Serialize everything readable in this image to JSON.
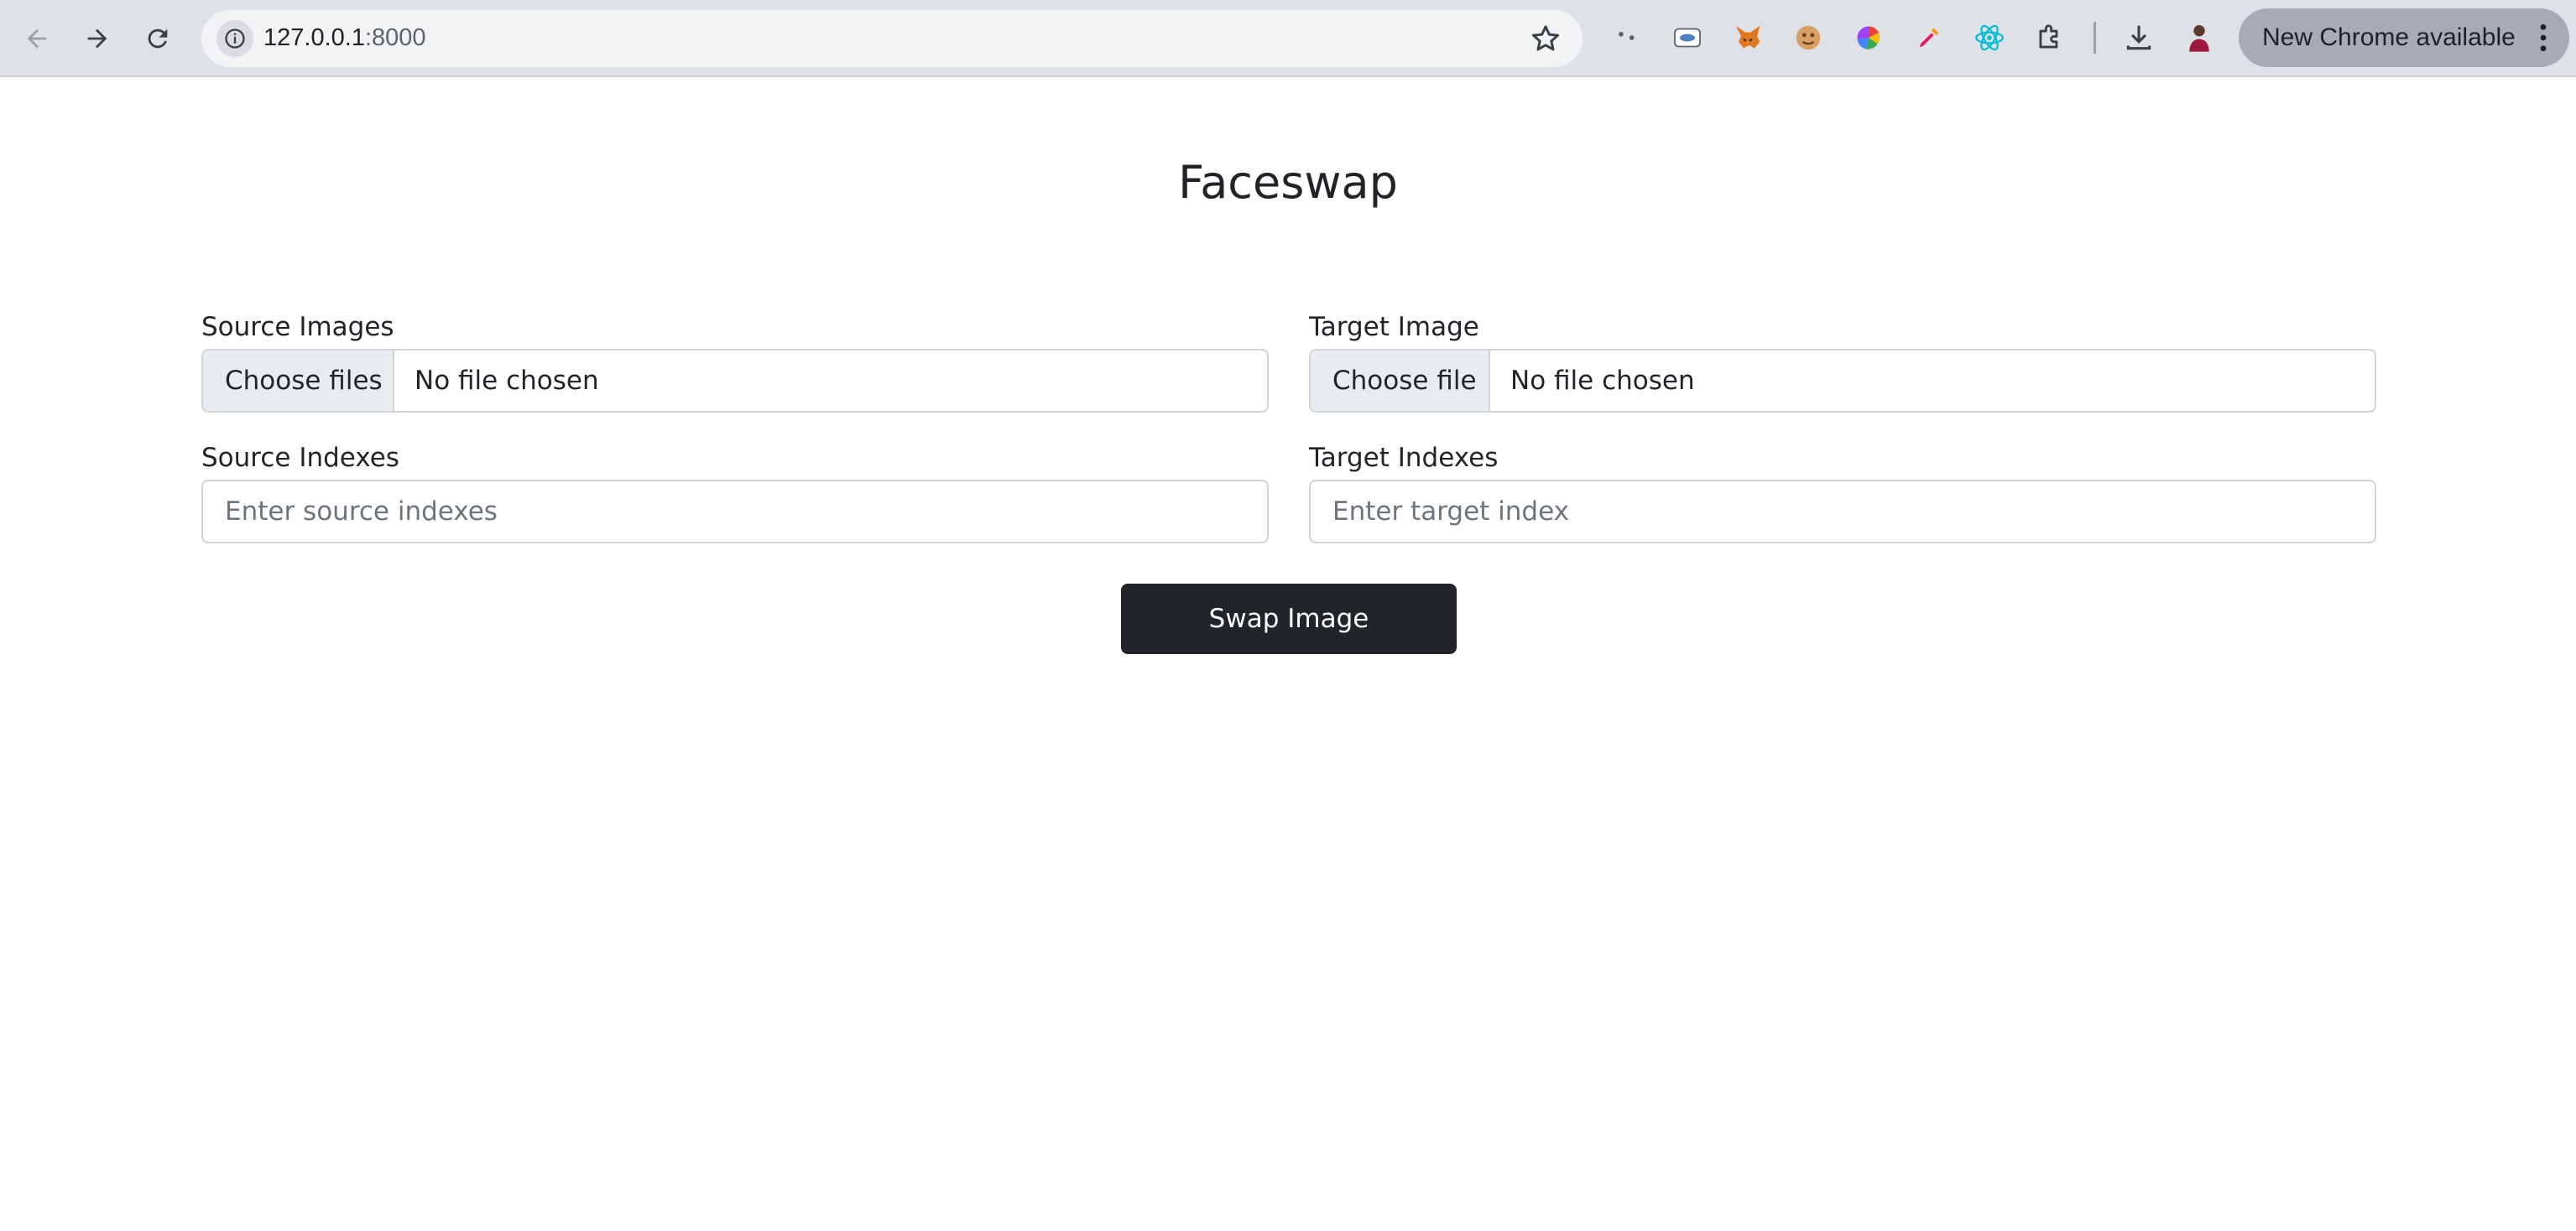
{
  "browser": {
    "url_host": "127.0.0.1",
    "url_port": ":8000",
    "update_label": "New Chrome available",
    "icons": [
      "back-arrow-icon",
      "forward-arrow-icon",
      "reload-icon",
      "site-info-icon",
      "bookmark-star-icon",
      "extension-dots-icon",
      "extension-rounded-icon",
      "metamask-fox-icon",
      "extension-cookie-icon",
      "color-wheel-icon",
      "color-picker-icon",
      "react-devtools-icon",
      "extensions-puzzle-icon",
      "download-icon",
      "profile-avatar-icon",
      "kebab-menu-icon"
    ]
  },
  "page": {
    "title": "Faceswap"
  },
  "form": {
    "source_images": {
      "label": "Source Images",
      "button": "Choose files",
      "status": "No file chosen"
    },
    "target_image": {
      "label": "Target Image",
      "button": "Choose file",
      "status": "No file chosen"
    },
    "source_indexes": {
      "label": "Source Indexes",
      "placeholder": "Enter source indexes",
      "value": ""
    },
    "target_indexes": {
      "label": "Target Indexes",
      "placeholder": "Enter target index",
      "value": ""
    },
    "submit_label": "Swap Image"
  },
  "colors": {
    "chrome_bg": "#dee1e6",
    "omnibox_bg": "#f1f3f4",
    "button_dark": "#212529",
    "input_border": "#ced4da",
    "file_button_bg": "#e9ecef"
  }
}
